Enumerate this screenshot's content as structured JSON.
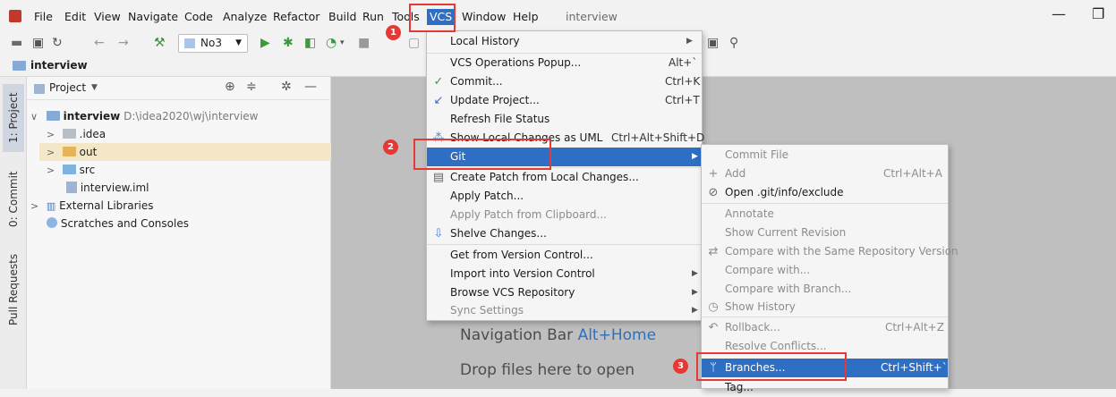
{
  "menubar": {
    "items": [
      "File",
      "Edit",
      "View",
      "Navigate",
      "Code",
      "Analyze",
      "Refactor",
      "Build",
      "Run",
      "Tools",
      "VCS",
      "Window",
      "Help"
    ],
    "window_title": "interview",
    "minimize": "—",
    "restore": "❐"
  },
  "toolbar": {
    "run_config": "No3",
    "run_config_arrow": "▼"
  },
  "navbar": {
    "project": "interview"
  },
  "left_tabs": [
    "1: Project",
    "0: Commit",
    "Pull Requests"
  ],
  "project_panel": {
    "title": "Project",
    "title_arrow": "▼",
    "tree": [
      {
        "label": "interview",
        "extra": "D:\\idea2020\\wj\\interview",
        "arrow": "∨"
      },
      {
        "label": ".idea",
        "arrow": ">"
      },
      {
        "label": "out",
        "arrow": ">"
      },
      {
        "label": "src",
        "arrow": ">"
      },
      {
        "label": "interview.iml",
        "arrow": ""
      },
      {
        "label": "External Libraries",
        "arrow": ">"
      },
      {
        "label": "Scratches and Consoles",
        "arrow": ""
      }
    ]
  },
  "editor": {
    "nav_hint": "Navigation Bar",
    "nav_shortcut": "Alt+Home",
    "drop_hint": "Drop files here to open"
  },
  "vcs_menu": {
    "items": [
      {
        "label": "Local History",
        "shortcut": "",
        "submenu": true
      },
      {
        "label": "VCS Operations Popup...",
        "shortcut": "Alt+`"
      },
      {
        "label": "Commit...",
        "shortcut": "Ctrl+K"
      },
      {
        "label": "Update Project...",
        "shortcut": "Ctrl+T"
      },
      {
        "label": "Refresh File Status",
        "shortcut": ""
      },
      {
        "label": "Show Local Changes as UML",
        "shortcut": "Ctrl+Alt+Shift+D"
      },
      {
        "label": "Git",
        "shortcut": "",
        "submenu": true
      },
      {
        "label": "Create Patch from Local Changes...",
        "shortcut": ""
      },
      {
        "label": "Apply Patch...",
        "shortcut": ""
      },
      {
        "label": "Apply Patch from Clipboard...",
        "shortcut": ""
      },
      {
        "label": "Shelve Changes...",
        "shortcut": ""
      },
      {
        "label": "Get from Version Control...",
        "shortcut": ""
      },
      {
        "label": "Import into Version Control",
        "shortcut": "",
        "submenu": true
      },
      {
        "label": "Browse VCS Repository",
        "shortcut": "",
        "submenu": true
      },
      {
        "label": "Sync Settings",
        "shortcut": "",
        "submenu": true
      }
    ]
  },
  "git_menu": {
    "items": [
      {
        "label": "Commit File",
        "shortcut": ""
      },
      {
        "label": "Add",
        "shortcut": "Ctrl+Alt+A"
      },
      {
        "label": "Open .git/info/exclude",
        "shortcut": ""
      },
      {
        "label": "Annotate",
        "shortcut": ""
      },
      {
        "label": "Show Current Revision",
        "shortcut": ""
      },
      {
        "label": "Compare with the Same Repository Version",
        "shortcut": ""
      },
      {
        "label": "Compare with...",
        "shortcut": ""
      },
      {
        "label": "Compare with Branch...",
        "shortcut": ""
      },
      {
        "label": "Show History",
        "shortcut": ""
      },
      {
        "label": "Rollback...",
        "shortcut": "Ctrl+Alt+Z"
      },
      {
        "label": "Resolve Conflicts...",
        "shortcut": ""
      },
      {
        "label": "Branches...",
        "shortcut": "Ctrl+Shift+`"
      },
      {
        "label": "Tag...",
        "shortcut": ""
      }
    ]
  },
  "annotations": {
    "badges": [
      "1",
      "2",
      "3"
    ]
  },
  "colors": {
    "selection": "#2e6fc4",
    "annotation": "#e53935",
    "editor_bg": "#bfbfbf"
  }
}
